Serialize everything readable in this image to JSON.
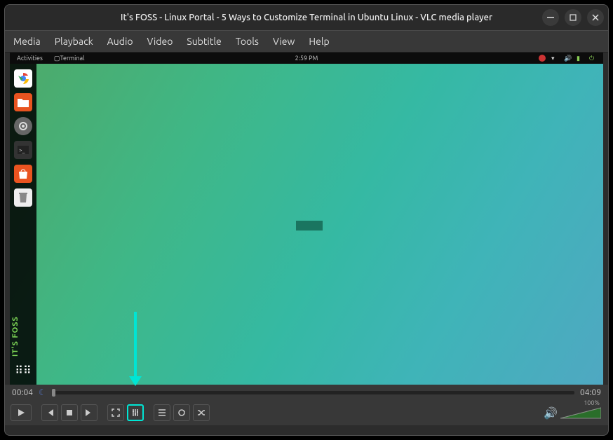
{
  "window": {
    "title": "It's FOSS - Linux Portal - 5 Ways to Customize Terminal in Ubuntu Linux - VLC media player"
  },
  "menubar": [
    "Media",
    "Playback",
    "Audio",
    "Video",
    "Subtitle",
    "Tools",
    "View",
    "Help"
  ],
  "desktop": {
    "activities": "Activities",
    "app": "Terminal",
    "clock": "2:59 PM",
    "watermark": "IT'S FOSS"
  },
  "playback": {
    "elapsed": "00:04",
    "total": "04:09",
    "volume_pct": "100%"
  }
}
